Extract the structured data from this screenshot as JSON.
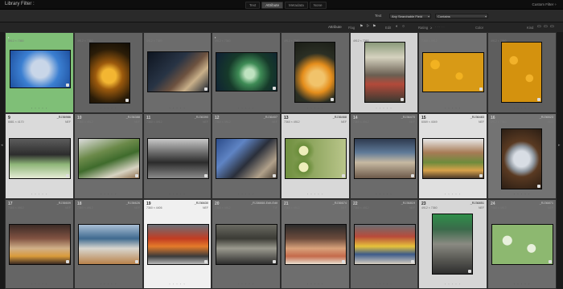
{
  "app": {
    "title": "Library Filter :",
    "preset": "Custom Filter ÷"
  },
  "filter_tabs": [
    {
      "label": "Text",
      "active": false
    },
    {
      "label": "Attribute",
      "active": true
    },
    {
      "label": "Metadata",
      "active": false
    },
    {
      "label": "None",
      "active": false
    }
  ],
  "text_filter": {
    "label": "Text",
    "field": "Any Searchable Field",
    "rule": "Contains",
    "search_icon": "search-icon"
  },
  "attribute_bar": {
    "label": "Attribute",
    "flag": "Flag",
    "edits": "Edit",
    "rating": "Rating",
    "rating_op": "≥",
    "color": "Color",
    "kind": "Kind",
    "color_swatches": [
      "#c0392b",
      "#d4b026",
      "#3a8f3a",
      "#2f61a8",
      "#7a3e9a",
      "#8a8a8a",
      "#5a5a5a"
    ]
  },
  "rows": [
    [
      {
        "num": "",
        "dim": "4912 × 7360",
        "file": "",
        "type": "",
        "photo": "fish",
        "flag": "flag-icon"
      },
      {
        "num": "",
        "dim": "4912 × 7360",
        "file": "",
        "type": "",
        "photo": "lantern"
      },
      {
        "num": "",
        "dim": "4912 × 7360",
        "file": "",
        "type": "",
        "photo": "chicken"
      },
      {
        "num": "",
        "dim": "4912 × 7360",
        "file": "",
        "type": "",
        "photo": "flower",
        "flag": "flag-icon"
      },
      {
        "num": "",
        "dim": "4912 × 7360",
        "file": "",
        "type": "",
        "photo": "pumpkin"
      },
      {
        "num": "",
        "dim": "4912 × 7360",
        "file": "",
        "type": "",
        "photo": "street"
      },
      {
        "num": "",
        "dim": "7360 × 4912",
        "file": "",
        "type": "",
        "photo": "oranges"
      },
      {
        "num": "",
        "dim": "4912 × 7360",
        "file": "",
        "type": "",
        "photo": "oranges2"
      }
    ],
    [
      {
        "num": "9",
        "dim": "6681 × 4170",
        "file": "_RJ36986",
        "type": "NEF",
        "photo": "cabbage"
      },
      {
        "num": "10",
        "dim": "7360 × 4912",
        "file": "_RJ36388",
        "type": "NEF",
        "photo": "greens"
      },
      {
        "num": "11",
        "dim": "7360 × 4912",
        "file": "_RJ36390",
        "type": "NEF",
        "photo": "bikes"
      },
      {
        "num": "12",
        "dim": "7360 × 4912",
        "file": "_RJ36407",
        "type": "NEF",
        "photo": "bluebike"
      },
      {
        "num": "13",
        "dim": "7360 × 4912",
        "file": "_RJ36468",
        "type": "NEF",
        "photo": "platter"
      },
      {
        "num": "14",
        "dim": "7360 × 4912",
        "file": "_RJ36470",
        "type": "NEF",
        "photo": "market"
      },
      {
        "num": "15",
        "dim": "6069 × 4049",
        "file": "_RJ36483",
        "type": "NEF",
        "photo": "stall"
      },
      {
        "num": "16",
        "dim": "4912 × 7360",
        "file": "_RJ36523",
        "type": "NEF",
        "photo": "fishbasket"
      }
    ],
    [
      {
        "num": "17",
        "dim": "7360 × 4912",
        "file": "_RJ36609",
        "type": "NEF",
        "photo": "vendor"
      },
      {
        "num": "18",
        "dim": "7360 × 4912",
        "file": "_RJ36626",
        "type": "NEF",
        "photo": "woman"
      },
      {
        "num": "19",
        "dim": "7360 × 4406",
        "file": "_RJ36630",
        "type": "NEF",
        "photo": "shop"
      },
      {
        "num": "20",
        "dim": "7360 × 4912",
        "file": "_RJ36668-Edit-Edit",
        "type": "TIF",
        "photo": "alley"
      },
      {
        "num": "21",
        "dim": "7360 × 4912",
        "file": "_RJ36674",
        "type": "NEF",
        "photo": "meat"
      },
      {
        "num": "22",
        "dim": "7360 × 4912",
        "file": "_RJ36819",
        "type": "NEF",
        "photo": "stalls2"
      },
      {
        "num": "23",
        "dim": "4912 × 7360",
        "file": "_RJ36851",
        "type": "NEF",
        "photo": "tentmarket"
      },
      {
        "num": "24",
        "dim": "7360 × 4912",
        "file": "_RJ36871",
        "type": "NEF",
        "photo": "cabbage2"
      }
    ]
  ],
  "dots": "◦ ◦ ◦ ◦ ◦",
  "sidebar_arrows": {
    "left": "◂",
    "right": "▸"
  }
}
